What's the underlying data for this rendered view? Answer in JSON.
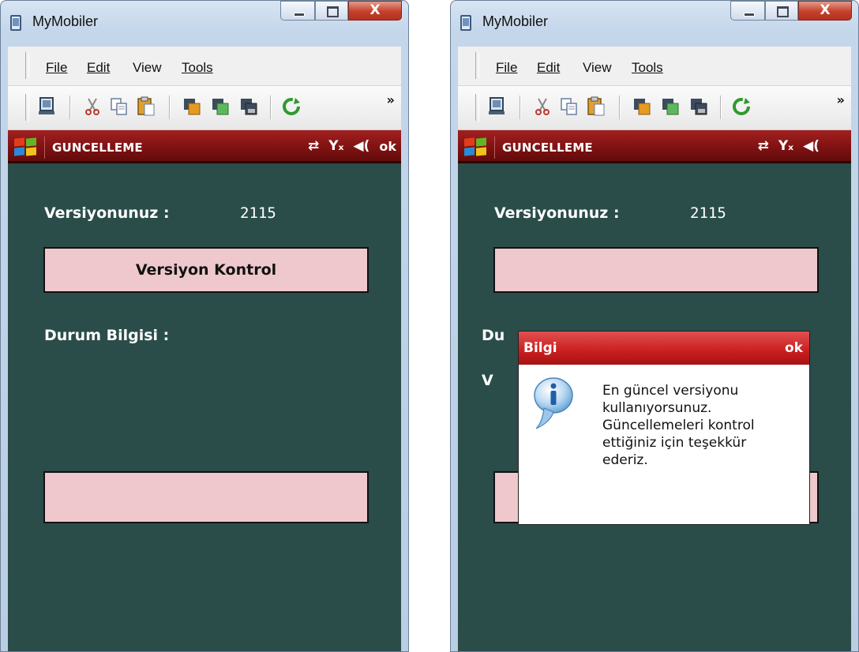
{
  "windows": [
    {
      "title": "MyMobiler",
      "close_glyph": "X",
      "menu": {
        "file": "File",
        "edit": "Edit",
        "view": "View",
        "tools": "Tools"
      },
      "toolbar_overflow": "»",
      "device": {
        "app_title": "GUNCELLEME",
        "softkey_ok": "ok",
        "version_label": "Versiyonunuz :",
        "version_value": "2115",
        "check_button": "Versiyon Kontrol",
        "status_label": "Durum Bilgisi :"
      }
    },
    {
      "title": "MyMobiler",
      "close_glyph": "X",
      "menu": {
        "file": "File",
        "edit": "Edit",
        "view": "View",
        "tools": "Tools"
      },
      "toolbar_overflow": "»",
      "device": {
        "app_title": "GUNCELLEME",
        "version_label": "Versiyonunuz :",
        "version_value": "2115",
        "obscured_label_1": "Du",
        "obscured_label_2": "V",
        "dialog": {
          "title": "Bilgi",
          "ok": "ok",
          "message": "En güncel versiyonu\nkullanıyorsunuz.\nGüncellemeleri kontrol\nettiğiniz için teşekkür\nederiz.",
          "icon": "info-icon"
        }
      }
    }
  ],
  "icons": {
    "toolbar": [
      "device-icon",
      "cut-icon",
      "copy-icon",
      "paste-icon",
      "send-file-icon",
      "receive-file-icon",
      "capture-icon",
      "refresh-icon"
    ],
    "status": [
      "connectivity-icon",
      "no-signal-icon",
      "volume-icon"
    ]
  },
  "colors": {
    "screen_bg": "#2a4d4a",
    "title_bar_red": "#8b1414",
    "pink_button": "#eec8cc",
    "dialog_header": "#c91e1e"
  }
}
